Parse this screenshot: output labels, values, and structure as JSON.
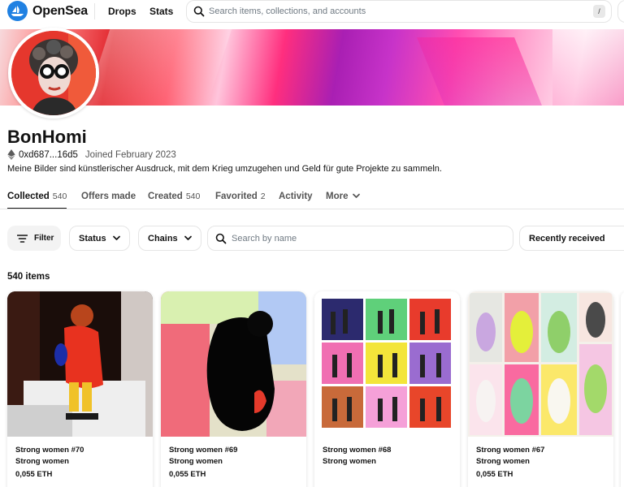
{
  "nav": {
    "brand": "OpenSea",
    "links": [
      "Drops",
      "Stats"
    ],
    "search_placeholder": "Search items, collections, and accounts",
    "search_shortcut": "/"
  },
  "profile": {
    "name": "BonHomi",
    "address": "0xd687...16d5",
    "joined": "Joined February 2023",
    "bio": "Meine Bilder sind künstlerischer Ausdruck, mit dem Krieg umzugehen und Geld für gute Projekte zu sammeln."
  },
  "tabs": [
    {
      "label": "Collected",
      "count": "540"
    },
    {
      "label": "Offers made",
      "count": ""
    },
    {
      "label": "Created",
      "count": "540"
    },
    {
      "label": "Favorited",
      "count": "2"
    },
    {
      "label": "Activity",
      "count": ""
    },
    {
      "label": "More",
      "count": ""
    }
  ],
  "filters": {
    "filter_label": "Filter",
    "status_label": "Status",
    "chains_label": "Chains",
    "search_placeholder": "Search by name",
    "sort_label": "Recently received"
  },
  "items_count": "540 items",
  "cards": [
    {
      "title": "Strong women #70",
      "collection": "Strong women",
      "price": "0,055 ETH"
    },
    {
      "title": "Strong women #69",
      "collection": "Strong women",
      "price": "0,055 ETH"
    },
    {
      "title": "Strong women #68",
      "collection": "Strong women",
      "price": ""
    },
    {
      "title": "Strong women #67",
      "collection": "Strong women",
      "price": "0,055 ETH"
    }
  ],
  "colors": {
    "brand_blue": "#2081e2",
    "text_primary": "#121212",
    "text_secondary": "#545454",
    "border": "#e5e5e5"
  }
}
